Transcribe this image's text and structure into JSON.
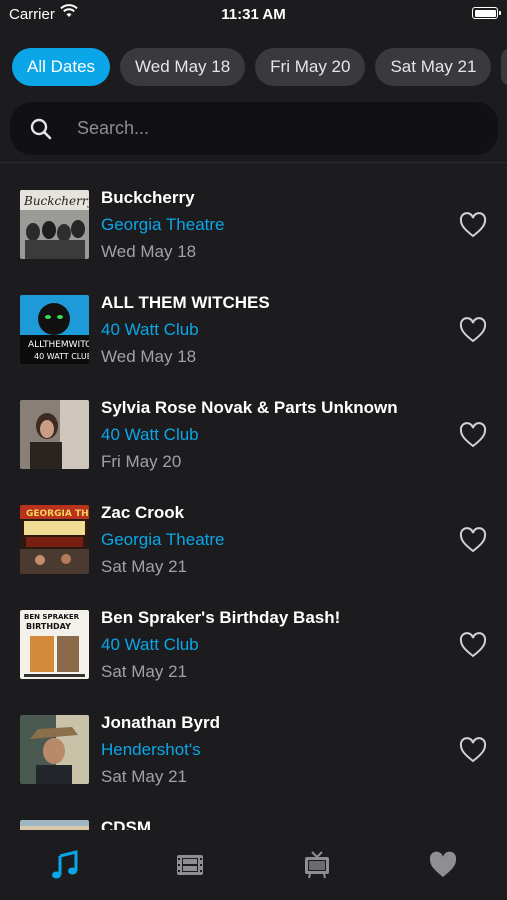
{
  "status": {
    "carrier": "Carrier",
    "time": "11:31 AM"
  },
  "filters": [
    "All Dates",
    "Wed May 18",
    "Fri May 20",
    "Sat May 21"
  ],
  "search": {
    "placeholder": "Search..."
  },
  "events": [
    {
      "title": "Buckcherry",
      "venue": "Georgia Theatre",
      "date": "Wed May 18",
      "favorited": false
    },
    {
      "title": "ALL THEM WITCHES",
      "venue": "40 Watt Club",
      "date": "Wed May 18",
      "favorited": false
    },
    {
      "title": "Sylvia Rose Novak & Parts Unknown",
      "venue": "40 Watt Club",
      "date": "Fri May 20",
      "favorited": false
    },
    {
      "title": "Zac Crook",
      "venue": "Georgia Theatre",
      "date": "Sat May 21",
      "favorited": false
    },
    {
      "title": "Ben Spraker's Birthday Bash!",
      "venue": "40 Watt Club",
      "date": "Sat May 21",
      "favorited": false
    },
    {
      "title": "Jonathan Byrd",
      "venue": "Hendershot's",
      "date": "Sat May 21",
      "favorited": false
    },
    {
      "title": "CDSM",
      "venue": "",
      "date": "",
      "favorited": false
    }
  ],
  "tabs": [
    {
      "icon": "music-note-icon",
      "active": true
    },
    {
      "icon": "film-icon",
      "active": false
    },
    {
      "icon": "tv-icon",
      "active": false
    },
    {
      "icon": "heart-icon",
      "active": false
    }
  ],
  "colors": {
    "accent": "#0aa6e8",
    "background": "#1c1c1e",
    "chip": "#3a3a3c",
    "inactive_icon": "#8e8e93"
  }
}
